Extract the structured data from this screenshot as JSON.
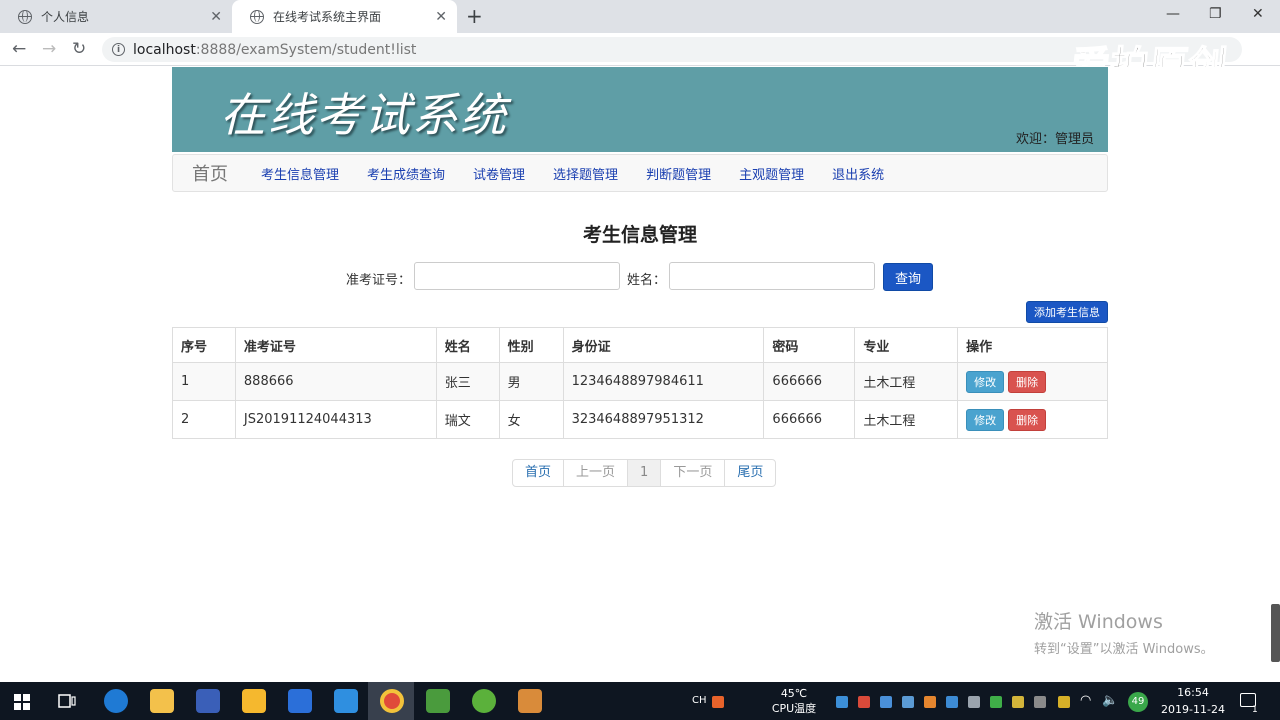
{
  "browser": {
    "tabs": [
      {
        "title": "个人信息",
        "close": "✕"
      },
      {
        "title": "在线考试系统主界面",
        "close": "✕"
      }
    ],
    "new_tab": "+",
    "window_controls": {
      "minimize": "—",
      "restore": "❐",
      "close": "✕"
    },
    "nav": {
      "back": "←",
      "forward": "→",
      "reload": "↻"
    },
    "url_host": "localhost",
    "url_path": ":8888/examSystem/student!list",
    "watermark": "爱拍原创"
  },
  "header": {
    "title": "在线考试系统",
    "welcome_label": "欢迎：",
    "welcome_user": "管理员"
  },
  "navbar": {
    "brand": "首页",
    "items": [
      "考生信息管理",
      "考生成绩查询",
      "试卷管理",
      "选择题管理",
      "判断题管理",
      "主观题管理",
      "退出系统"
    ]
  },
  "main": {
    "heading": "考生信息管理",
    "search": {
      "id_label": "准考证号：",
      "id_value": "",
      "name_label": "姓名：",
      "name_value": "",
      "query_button": "查询"
    },
    "add_button": "添加考生信息",
    "table": {
      "columns": [
        "序号",
        "准考证号",
        "姓名",
        "性别",
        "身份证",
        "密码",
        "专业",
        "操作"
      ],
      "rows": [
        [
          "1",
          "888666",
          "张三",
          "男",
          "1234648897984611",
          "666666",
          "土木工程"
        ],
        [
          "2",
          "JS20191124044313",
          "瑞文",
          "女",
          "3234648897951312",
          "666666",
          "土木工程"
        ]
      ],
      "edit_label": "修改",
      "delete_label": "删除"
    },
    "pagination": {
      "first": "首页",
      "prev": "上一页",
      "current": "1",
      "next": "下一页",
      "last": "尾页"
    }
  },
  "activation": {
    "line1": "激活 Windows",
    "line2": "转到“设置”以激活 Windows。"
  },
  "taskbar": {
    "ime": "CH",
    "temp": "45℃",
    "temp_label": "CPU温度",
    "badge": "49",
    "time": "16:54",
    "date": "2019-11-24",
    "notify_count": "1"
  },
  "colors": {
    "banner": "#5f9ea6",
    "primary_button": "#1b57c4",
    "edit_button": "#4aa3cf",
    "delete_button": "#d9534f",
    "nav_link": "#1a3fb0"
  }
}
